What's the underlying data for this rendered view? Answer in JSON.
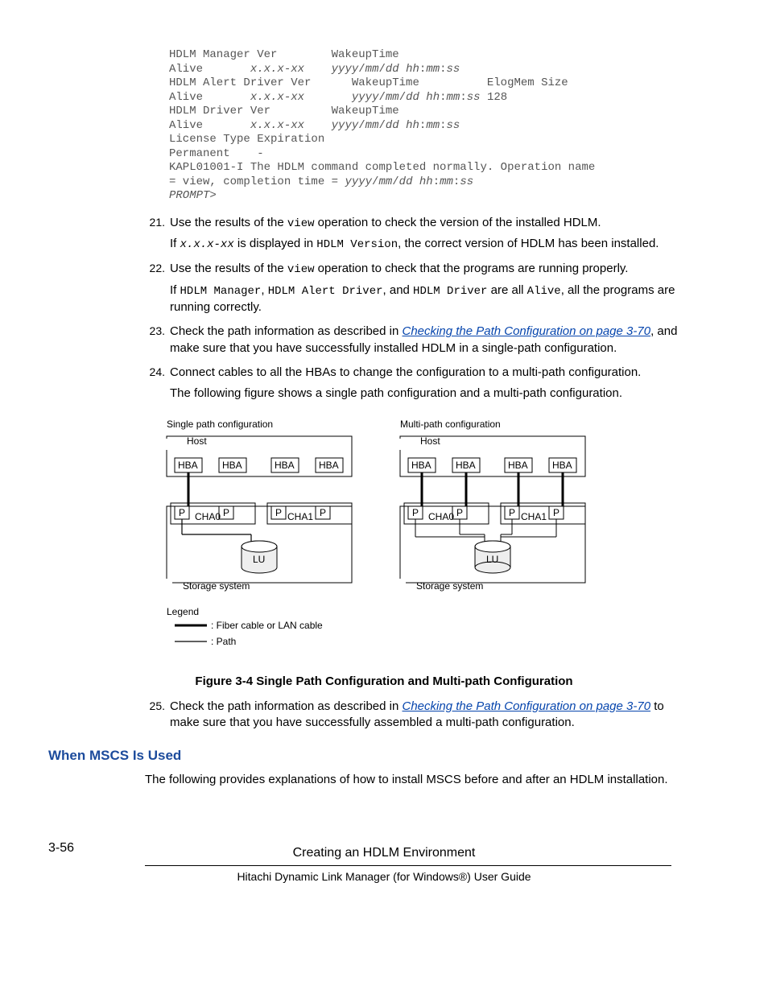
{
  "code": {
    "l1": "HDLM Manager Ver        WakeupTime",
    "l2a": "Alive       ",
    "l2b": "x.x.x-xx",
    "l2c": "    ",
    "l2d": "yyyy",
    "l2e": "/",
    "l2f": "mm",
    "l2g": "/",
    "l2h": "dd hh",
    "l2i": ":",
    "l2j": "mm",
    "l2k": ":",
    "l2l": "ss",
    "l3": "HDLM Alert Driver Ver      WakeupTime          ElogMem Size",
    "l4a": "Alive       ",
    "l4b": "x.x.x-xx",
    "l4c": "       ",
    "l4d": "yyyy",
    "l4e": "/",
    "l4f": "mm",
    "l4g": "/",
    "l4h": "dd hh",
    "l4i": ":",
    "l4j": "mm",
    "l4k": ":",
    "l4l": "ss",
    "l4m": " 128",
    "l5": "HDLM Driver Ver         WakeupTime",
    "l6a": "Alive       ",
    "l6b": "x.x.x-xx",
    "l6c": "    ",
    "l6d": "yyyy",
    "l6e": "/",
    "l6f": "mm",
    "l6g": "/",
    "l6h": "dd hh",
    "l6i": ":",
    "l6j": "mm",
    "l6k": ":",
    "l6l": "ss",
    "l7": "License Type Expiration",
    "l8": "Permanent    -",
    "l9": "KAPL01001-I The HDLM command completed normally. Operation name",
    "l10a": "= view, completion time = ",
    "l10b": "yyyy",
    "l10c": "/",
    "l10d": "mm",
    "l10e": "/",
    "l10f": "dd hh",
    "l10g": ":",
    "l10h": "mm",
    "l10i": ":",
    "l10j": "ss",
    "l11": "PROMPT",
    "l11b": ">"
  },
  "steps": {
    "s21": {
      "n": "21.",
      "a": "Use the results of the ",
      "b": "view",
      "c": " operation to check the version of the installed HDLM.",
      "p2a": "If ",
      "p2b": "x.x.x-xx",
      "p2c": " is displayed in ",
      "p2d": "HDLM Version",
      "p2e": ", the correct version of HDLM has been installed."
    },
    "s22": {
      "n": "22.",
      "a": "Use the results of the ",
      "b": "view",
      "c": " operation to check that the programs are running properly.",
      "p2a": "If ",
      "p2b": "HDLM Manager",
      "p2c": ", ",
      "p2d": "HDLM Alert Driver",
      "p2e": ", and ",
      "p2f": "HDLM Driver",
      "p2g": " are all ",
      "p2h": "Alive",
      "p2i": ", all the programs are running correctly."
    },
    "s23": {
      "n": "23.",
      "a": "Check the path information as described in ",
      "link": "Checking the Path Configuration on page 3-70",
      "c": ", and make sure that you have successfully installed HDLM in a single-path configuration."
    },
    "s24": {
      "n": "24.",
      "a": "Connect cables to all the HBAs to change the configuration to a multi-path configuration.",
      "p2": "The following figure shows a single path configuration and a multi-path configuration."
    },
    "s25": {
      "n": "25.",
      "a": "Check the path information as described in ",
      "link": "Checking the Path Configuration on page 3-70",
      "c": " to make sure that you have successfully assembled a multi-path configuration."
    }
  },
  "figure": {
    "title_left": "Single path configuration",
    "title_right": "Multi-path configuration",
    "host": "Host",
    "hba": "HBA",
    "p": "P",
    "cha0": "CHA0",
    "cha1": "CHA1",
    "lu": "LU",
    "storage": "Storage system",
    "legend": "Legend",
    "leg1": ": Fiber cable or LAN cable",
    "leg2": ": Path",
    "caption": "Figure 3-4 Single Path Configuration and Multi-path Configuration"
  },
  "section": {
    "head": "When MSCS Is Used",
    "body": "The following provides explanations of how to install MSCS before and after an HDLM installation."
  },
  "footer": {
    "page": "3-56",
    "line1": "Creating an HDLM Environment",
    "line2": "Hitachi Dynamic Link Manager (for Windows®) User Guide"
  }
}
